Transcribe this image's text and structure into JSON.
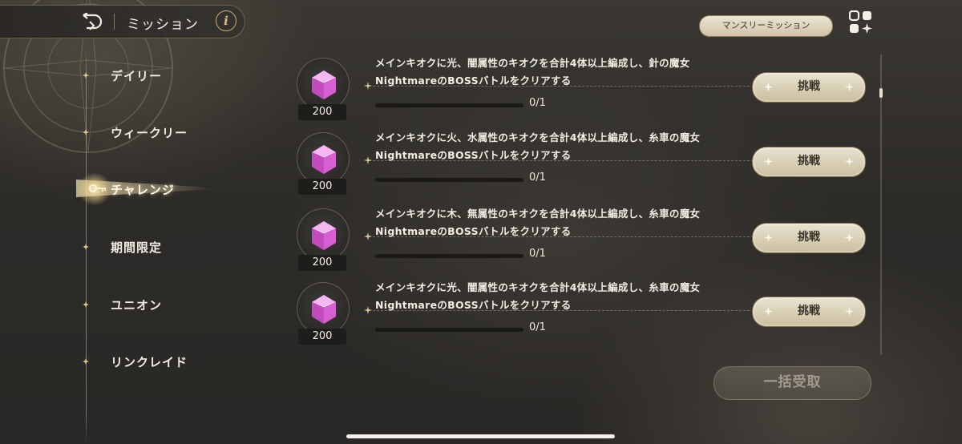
{
  "header": {
    "title": "ミッション",
    "info_label": "i"
  },
  "top_right": {
    "monthly_label": "マンスリーミッション"
  },
  "nav": {
    "items": [
      {
        "label": "デイリー"
      },
      {
        "label": "ウィークリー"
      },
      {
        "label": "チャレンジ",
        "active": true
      },
      {
        "label": "期間限定"
      },
      {
        "label": "ユニオン"
      },
      {
        "label": "リンクレイド"
      }
    ]
  },
  "missions": [
    {
      "text": "メインキオクに光、闇属性のキオクを合計4体以上編成し、針の魔女 NightmareのBOSSバトルをクリアする",
      "reward": "200",
      "progress_current": "0",
      "progress_sep": "/",
      "progress_total": "1",
      "button": "挑戦"
    },
    {
      "text": "メインキオクに火、水属性のキオクを合計4体以上編成し、糸車の魔女 NightmareのBOSSバトルをクリアする",
      "reward": "200",
      "progress_current": "0",
      "progress_sep": "/",
      "progress_total": "1",
      "button": "挑戦"
    },
    {
      "text": "メインキオクに木、無属性のキオクを合計4体以上編成し、糸車の魔女 NightmareのBOSSバトルをクリアする",
      "reward": "200",
      "progress_current": "0",
      "progress_sep": "/",
      "progress_total": "1",
      "button": "挑戦"
    },
    {
      "text": "メインキオクに光、闇属性のキオクを合計4体以上編成し、糸車の魔女 NightmareのBOSSバトルをクリアする",
      "reward": "200",
      "progress_current": "0",
      "progress_sep": "/",
      "progress_total": "1",
      "button": "挑戦"
    }
  ],
  "bulk_receive": {
    "label": "一括受取",
    "enabled": false
  },
  "colors": {
    "accent_gold": "#c9ae73",
    "button_bg": "#e9e2cf",
    "reward_gem": "#e06fd4"
  },
  "icons": {
    "back": "back-arrow-icon",
    "info": "info-icon",
    "menu": "grid-menu-icon",
    "reward": "pink-gem-icon"
  }
}
